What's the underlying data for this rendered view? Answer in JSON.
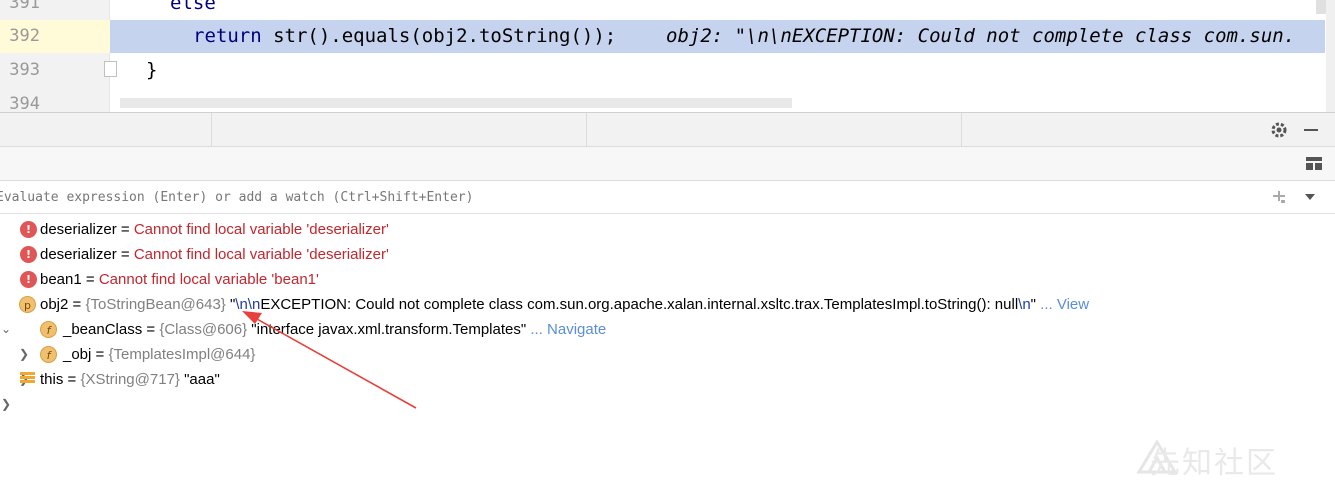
{
  "editor": {
    "lines": [
      {
        "number": "391",
        "code_kw": "",
        "code": "else"
      },
      {
        "number": "392",
        "code_kw": "return",
        "code": " str().equals(obj2.toString());",
        "inline_value": "obj2: \"\\n\\nEXCEPTION: Could not complete class com.sun."
      },
      {
        "number": "393",
        "code_kw": "",
        "code": "}"
      },
      {
        "number": "394",
        "code_kw": "",
        "code": ""
      }
    ]
  },
  "debug": {
    "eval_placeholder": "Evaluate expression (Enter) or add a watch (Ctrl+Shift+Enter)",
    "variables": [
      {
        "badge": "!",
        "name": "deserializer",
        "eq": " = ",
        "error": "Cannot find local variable 'deserializer'"
      },
      {
        "badge": "!",
        "name": "deserializer",
        "eq": " = ",
        "error": "Cannot find local variable 'deserializer'"
      },
      {
        "badge": "!",
        "name": "bean1",
        "eq": " = ",
        "error": "Cannot find local variable 'bean1'"
      },
      {
        "badge": "p",
        "name": "obj2",
        "eq": " = ",
        "type": "{ToStringBean@643} ",
        "q1": "\"",
        "esc1": "\\n\\n",
        "str": "EXCEPTION: Could not complete class com.sun.org.apache.xalan.internal.xsltc.trax.TemplatesImpl.toString(): null",
        "esc2": "\\n",
        "q2": "\"",
        "link": " ... View"
      },
      {
        "badge": "f",
        "name": "_beanClass",
        "eq": " = ",
        "type": "{Class@606} ",
        "str": "\"interface javax.xml.transform.Templates\"",
        "link": " ... Navigate"
      },
      {
        "badge": "f",
        "name": "_obj",
        "eq": " = ",
        "type": "{TemplatesImpl@644}"
      },
      {
        "badge": "lines",
        "name": "this",
        "eq": " = ",
        "type": "{XString@717} ",
        "str": "\"aaa\""
      }
    ]
  },
  "watermark": {
    "text": "先知社区"
  },
  "colors": {
    "highlight": "#c5d3ee",
    "error": "#c4262e",
    "link": "#5a8ddb",
    "annotation_arrow": "#e8403a"
  }
}
